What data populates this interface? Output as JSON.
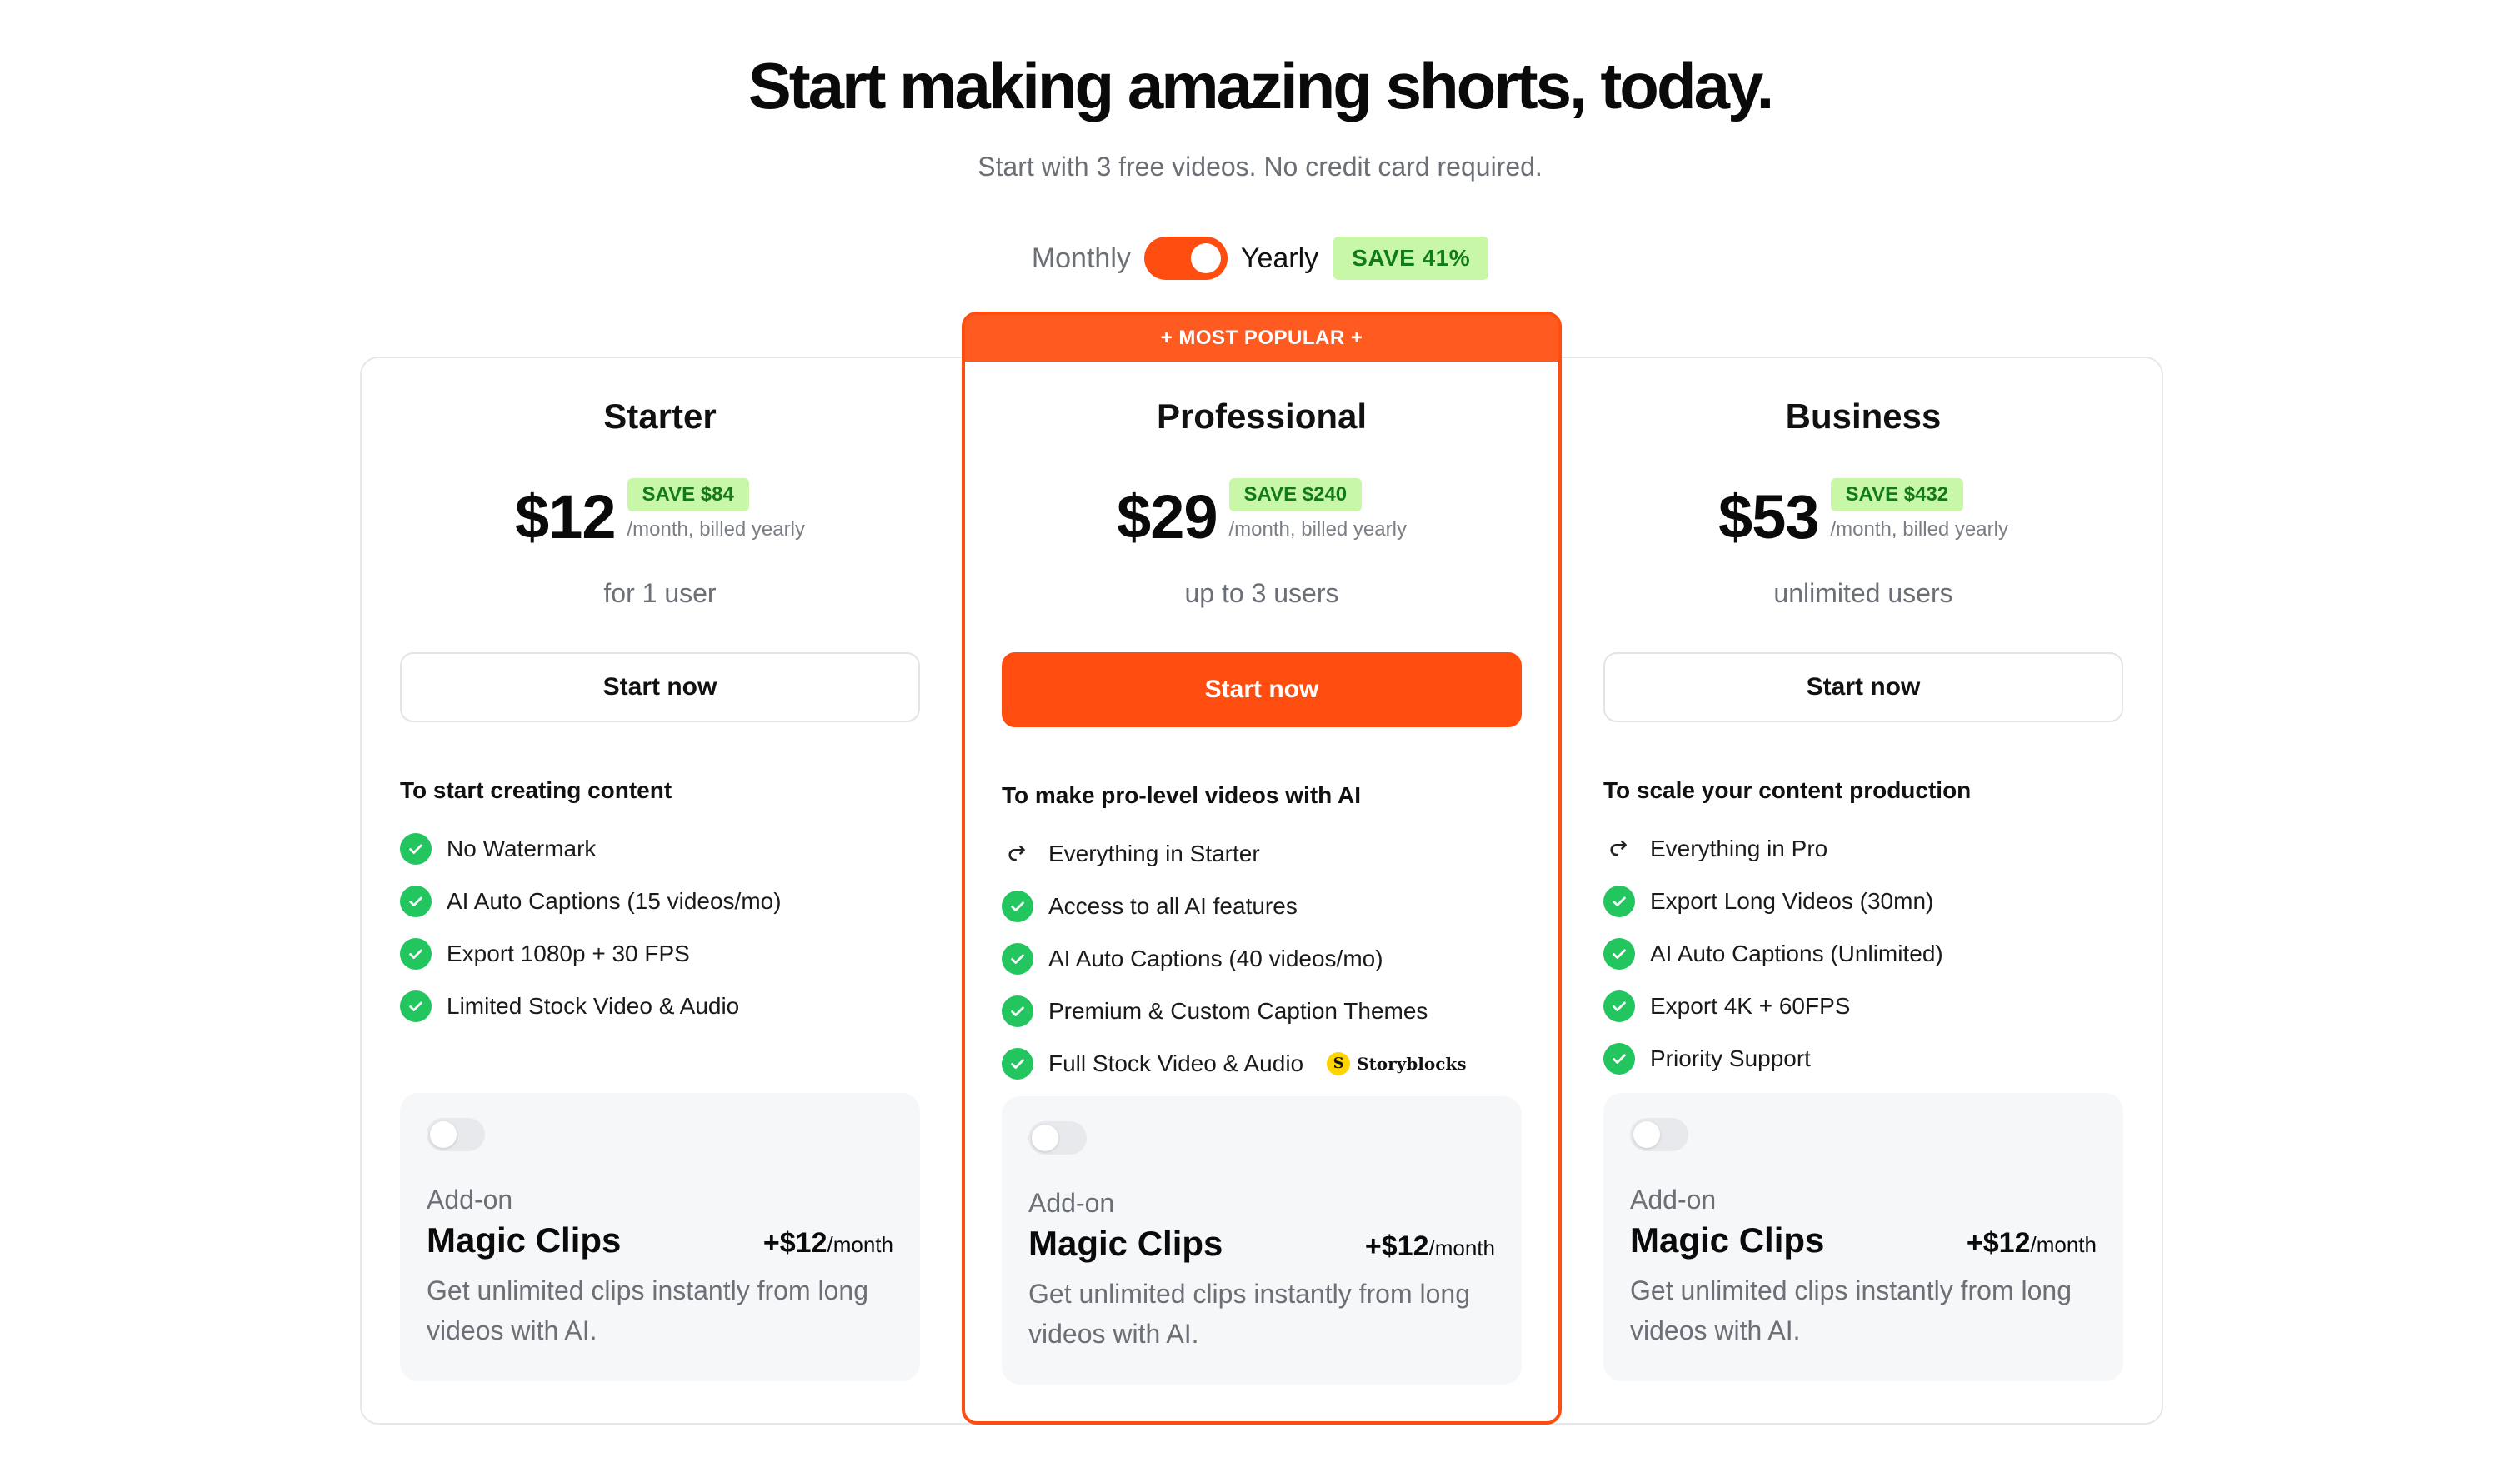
{
  "header": {
    "title": "Start making amazing shorts, today.",
    "subtitle": "Start with 3 free videos. No credit card required."
  },
  "billing": {
    "monthly_label": "Monthly",
    "yearly_label": "Yearly",
    "yearly_selected": true,
    "save_badge": "SAVE 41%"
  },
  "colors": {
    "accent": "#ff4d0f",
    "save_bg": "#c9f7a8",
    "save_text": "#137a18",
    "check": "#22c55e"
  },
  "plans": [
    {
      "name": "Starter",
      "price": "$12",
      "save": "SAVE $84",
      "period": "/month, billed yearly",
      "users": "for 1 user",
      "cta": "Start now",
      "features_title": "To start creating content",
      "features": [
        {
          "icon": "check-icon",
          "text": "No Watermark"
        },
        {
          "icon": "check-icon",
          "text": "AI Auto Captions (15 videos/mo)"
        },
        {
          "icon": "check-icon",
          "text": "Export 1080p + 30 FPS"
        },
        {
          "icon": "check-icon",
          "text": "Limited Stock Video & Audio"
        }
      ],
      "addon": {
        "label": "Add-on",
        "name": "Magic Clips",
        "price": "+$12",
        "unit": "/month",
        "desc": "Get unlimited clips instantly from long videos with AI.",
        "enabled": false
      }
    },
    {
      "name": "Professional",
      "badge": "+ MOST POPULAR +",
      "price": "$29",
      "save": "SAVE $240",
      "period": "/month, billed yearly",
      "users": "up to 3 users",
      "cta": "Start now",
      "features_title": "To make pro-level videos with AI",
      "features": [
        {
          "icon": "redo-arrow-icon",
          "text": "Everything in Starter"
        },
        {
          "icon": "check-icon",
          "text": "Access to all AI features"
        },
        {
          "icon": "check-icon",
          "text": "AI Auto Captions (40 videos/mo)"
        },
        {
          "icon": "check-icon",
          "text": "Premium & Custom Caption Themes"
        },
        {
          "icon": "check-icon",
          "text": "Full Stock Video & Audio",
          "partner": "Storyblocks"
        }
      ],
      "addon": {
        "label": "Add-on",
        "name": "Magic Clips",
        "price": "+$12",
        "unit": "/month",
        "desc": "Get unlimited clips instantly from long videos with AI.",
        "enabled": false
      }
    },
    {
      "name": "Business",
      "price": "$53",
      "save": "SAVE $432",
      "period": "/month, billed yearly",
      "users": "unlimited users",
      "cta": "Start now",
      "features_title": "To scale your content production",
      "features": [
        {
          "icon": "redo-arrow-icon",
          "text": "Everything in Pro"
        },
        {
          "icon": "check-icon",
          "text": "Export Long Videos (30mn)"
        },
        {
          "icon": "check-icon",
          "text": "AI Auto Captions (Unlimited)"
        },
        {
          "icon": "check-icon",
          "text": "Export 4K + 60FPS"
        },
        {
          "icon": "check-icon",
          "text": "Priority Support"
        }
      ],
      "addon": {
        "label": "Add-on",
        "name": "Magic Clips",
        "price": "+$12",
        "unit": "/month",
        "desc": "Get unlimited clips instantly from long videos with AI.",
        "enabled": false
      }
    }
  ]
}
